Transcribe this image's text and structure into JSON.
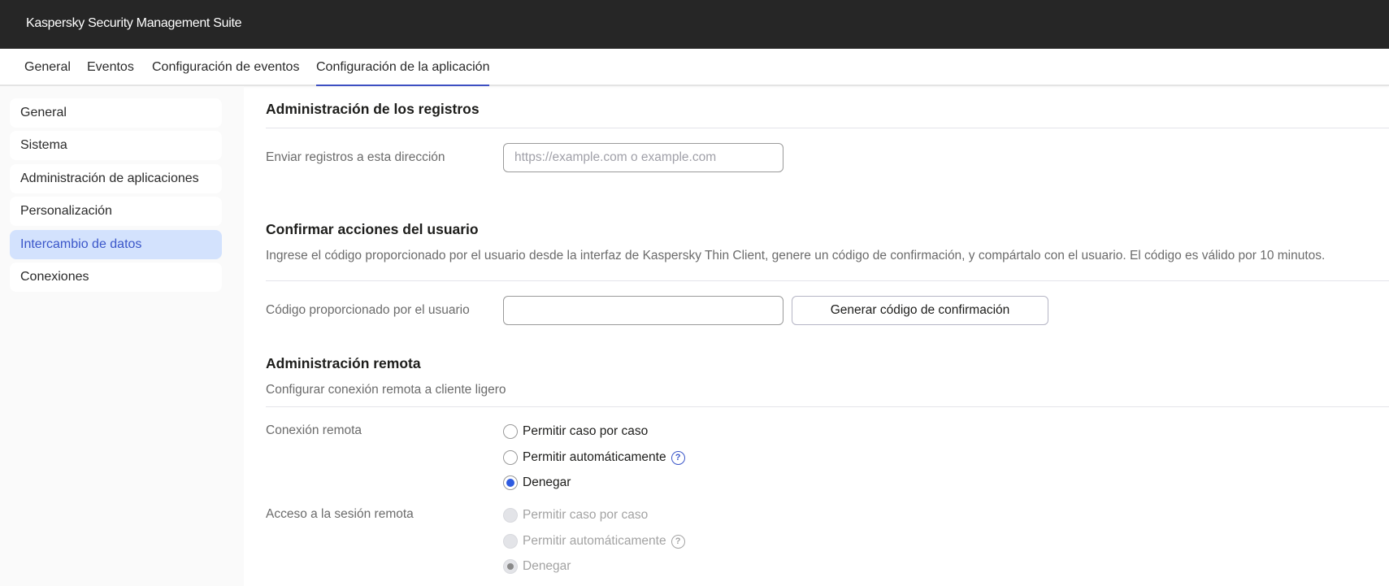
{
  "app": {
    "title": "Kaspersky Security Management Suite"
  },
  "tabs": [
    {
      "label": "General"
    },
    {
      "label": "Eventos"
    },
    {
      "label": "Configuración de eventos"
    },
    {
      "label": "Configuración de la aplicación",
      "active": true
    }
  ],
  "sidebar": {
    "items": [
      {
        "label": "General"
      },
      {
        "label": "Sistema"
      },
      {
        "label": "Administración de aplicaciones"
      },
      {
        "label": "Personalización"
      },
      {
        "label": "Intercambio de datos",
        "active": true
      },
      {
        "label": "Conexiones"
      }
    ]
  },
  "logs": {
    "title": "Administración de los registros",
    "field_label": "Enviar registros a esta dirección",
    "field_value": "",
    "field_placeholder": "https://example.com o example.com"
  },
  "confirm": {
    "title": "Confirmar acciones del usuario",
    "description": "Ingrese el código proporcionado por el usuario desde la interfaz de Kaspersky Thin Client, genere un código de confirmación, y compártalo con el usuario. El código es válido por 10 minutos.",
    "field_label": "Código proporcionado por el usuario",
    "field_value": "",
    "button": "Generar código de confirmación"
  },
  "remote": {
    "title": "Administración remota",
    "description": "Configurar conexión remota a cliente ligero",
    "connection": {
      "label": "Conexión remota",
      "options": [
        "Permitir caso por caso",
        "Permitir automáticamente",
        "Denegar"
      ],
      "selected": "Denegar",
      "disabled": false
    },
    "session": {
      "label": "Acceso a la sesión remota",
      "options": [
        "Permitir caso por caso",
        "Permitir automáticamente",
        "Denegar"
      ],
      "selected": "Denegar",
      "disabled": true
    },
    "help_glyph": "?"
  },
  "colors": {
    "accent": "#3a56c9",
    "header_bg": "#262626",
    "active_side_bg": "#d3e2fd",
    "radio_on": "#2e5be0"
  }
}
